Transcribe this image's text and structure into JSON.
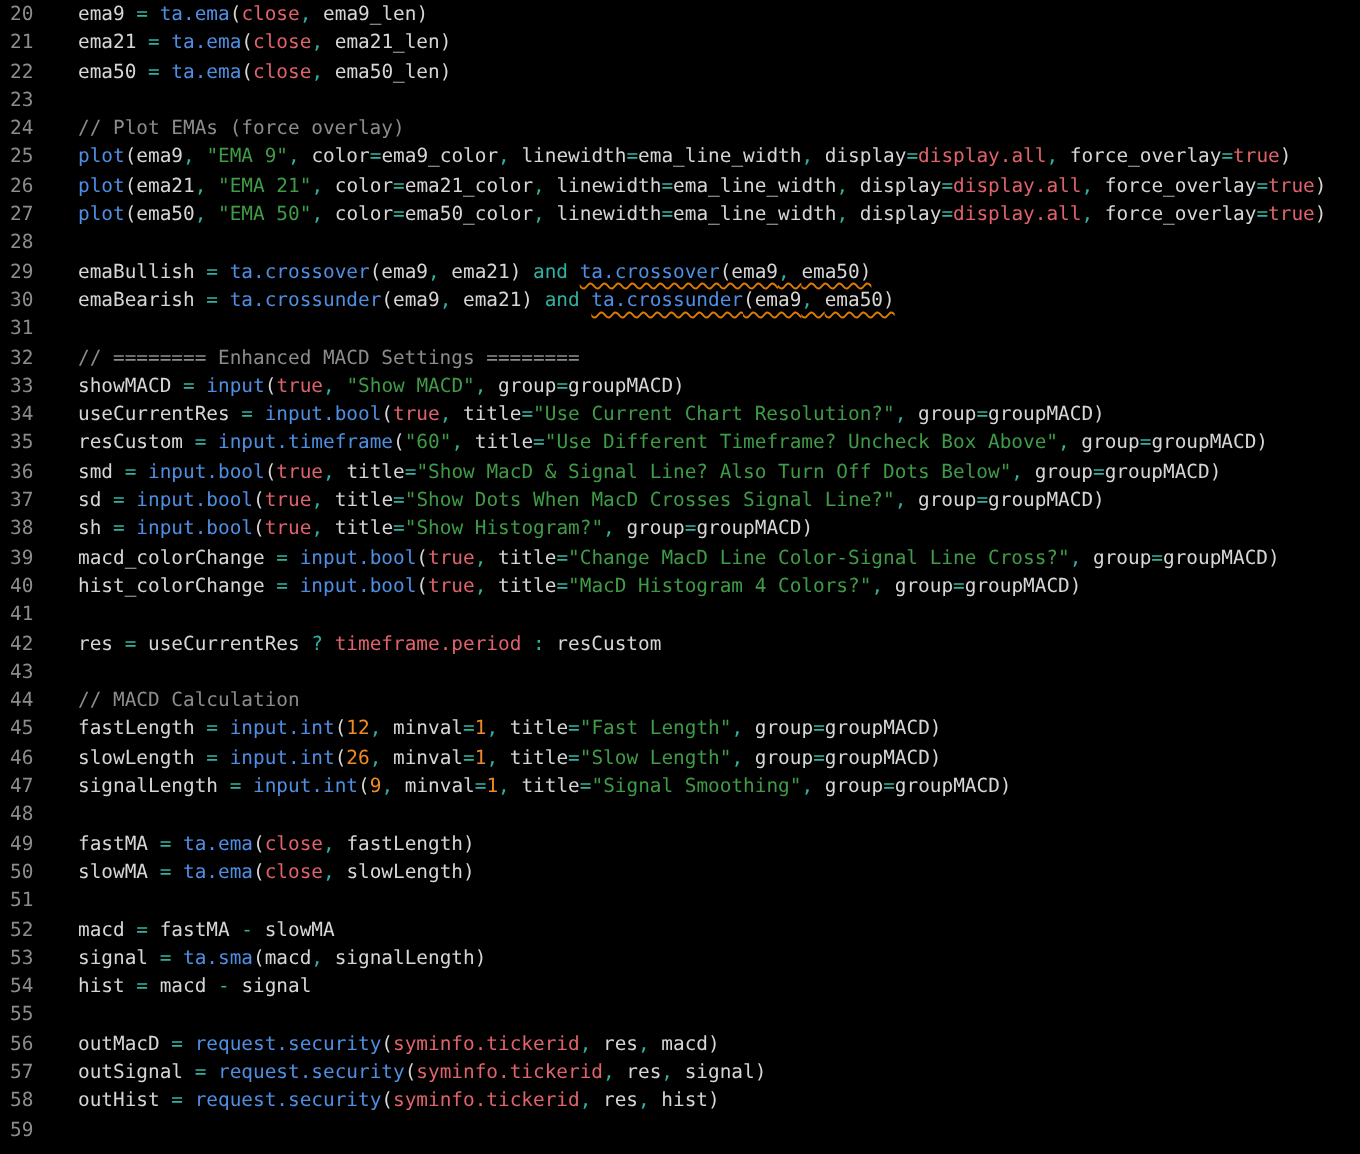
{
  "editor": {
    "lines": [
      {
        "number": "20",
        "tokens": [
          {
            "kind": "plain",
            "text": "ema9"
          },
          {
            "kind": "op",
            "text": " = "
          },
          {
            "kind": "fn",
            "text": "ta.ema"
          },
          {
            "kind": "plain",
            "text": "("
          },
          {
            "kind": "lit",
            "text": "close"
          },
          {
            "kind": "op",
            "text": ", "
          },
          {
            "kind": "plain",
            "text": "ema9_len)"
          }
        ]
      },
      {
        "number": "21",
        "tokens": [
          {
            "kind": "plain",
            "text": "ema21"
          },
          {
            "kind": "op",
            "text": " = "
          },
          {
            "kind": "fn",
            "text": "ta.ema"
          },
          {
            "kind": "plain",
            "text": "("
          },
          {
            "kind": "lit",
            "text": "close"
          },
          {
            "kind": "op",
            "text": ", "
          },
          {
            "kind": "plain",
            "text": "ema21_len)"
          }
        ]
      },
      {
        "number": "22",
        "tokens": [
          {
            "kind": "plain",
            "text": "ema50"
          },
          {
            "kind": "op",
            "text": " = "
          },
          {
            "kind": "fn",
            "text": "ta.ema"
          },
          {
            "kind": "plain",
            "text": "("
          },
          {
            "kind": "lit",
            "text": "close"
          },
          {
            "kind": "op",
            "text": ", "
          },
          {
            "kind": "plain",
            "text": "ema50_len)"
          }
        ]
      },
      {
        "number": "23"
      },
      {
        "number": "24",
        "tokens": [
          {
            "kind": "comment",
            "text": "// Plot EMAs (force overlay)"
          }
        ]
      },
      {
        "number": "25",
        "tokens": [
          {
            "kind": "fn",
            "text": "plot"
          },
          {
            "kind": "plain",
            "text": "(ema9"
          },
          {
            "kind": "op",
            "text": ", "
          },
          {
            "kind": "str",
            "text": "\"EMA 9\""
          },
          {
            "kind": "op",
            "text": ", "
          },
          {
            "kind": "plain",
            "text": "color"
          },
          {
            "kind": "op",
            "text": "="
          },
          {
            "kind": "plain",
            "text": "ema9_color"
          },
          {
            "kind": "op",
            "text": ", "
          },
          {
            "kind": "plain",
            "text": "linewidth"
          },
          {
            "kind": "op",
            "text": "="
          },
          {
            "kind": "plain",
            "text": "ema_line_width"
          },
          {
            "kind": "op",
            "text": ", "
          },
          {
            "kind": "plain",
            "text": "display"
          },
          {
            "kind": "op",
            "text": "="
          },
          {
            "kind": "lit",
            "text": "display.all"
          },
          {
            "kind": "op",
            "text": ", "
          },
          {
            "kind": "plain",
            "text": "force_overlay"
          },
          {
            "kind": "op",
            "text": "="
          },
          {
            "kind": "lit",
            "text": "true"
          },
          {
            "kind": "plain",
            "text": ")"
          }
        ]
      },
      {
        "number": "26",
        "tokens": [
          {
            "kind": "fn",
            "text": "plot"
          },
          {
            "kind": "plain",
            "text": "(ema21"
          },
          {
            "kind": "op",
            "text": ", "
          },
          {
            "kind": "str",
            "text": "\"EMA 21\""
          },
          {
            "kind": "op",
            "text": ", "
          },
          {
            "kind": "plain",
            "text": "color"
          },
          {
            "kind": "op",
            "text": "="
          },
          {
            "kind": "plain",
            "text": "ema21_color"
          },
          {
            "kind": "op",
            "text": ", "
          },
          {
            "kind": "plain",
            "text": "linewidth"
          },
          {
            "kind": "op",
            "text": "="
          },
          {
            "kind": "plain",
            "text": "ema_line_width"
          },
          {
            "kind": "op",
            "text": ", "
          },
          {
            "kind": "plain",
            "text": "display"
          },
          {
            "kind": "op",
            "text": "="
          },
          {
            "kind": "lit",
            "text": "display.all"
          },
          {
            "kind": "op",
            "text": ", "
          },
          {
            "kind": "plain",
            "text": "force_overlay"
          },
          {
            "kind": "op",
            "text": "="
          },
          {
            "kind": "lit",
            "text": "true"
          },
          {
            "kind": "plain",
            "text": ")"
          }
        ]
      },
      {
        "number": "27",
        "tokens": [
          {
            "kind": "fn",
            "text": "plot"
          },
          {
            "kind": "plain",
            "text": "(ema50"
          },
          {
            "kind": "op",
            "text": ", "
          },
          {
            "kind": "str",
            "text": "\"EMA 50\""
          },
          {
            "kind": "op",
            "text": ", "
          },
          {
            "kind": "plain",
            "text": "color"
          },
          {
            "kind": "op",
            "text": "="
          },
          {
            "kind": "plain",
            "text": "ema50_color"
          },
          {
            "kind": "op",
            "text": ", "
          },
          {
            "kind": "plain",
            "text": "linewidth"
          },
          {
            "kind": "op",
            "text": "="
          },
          {
            "kind": "plain",
            "text": "ema_line_width"
          },
          {
            "kind": "op",
            "text": ", "
          },
          {
            "kind": "plain",
            "text": "display"
          },
          {
            "kind": "op",
            "text": "="
          },
          {
            "kind": "lit",
            "text": "display.all"
          },
          {
            "kind": "op",
            "text": ", "
          },
          {
            "kind": "plain",
            "text": "force_overlay"
          },
          {
            "kind": "op",
            "text": "="
          },
          {
            "kind": "lit",
            "text": "true"
          },
          {
            "kind": "plain",
            "text": ")"
          }
        ]
      },
      {
        "number": "28"
      },
      {
        "number": "29",
        "tokens": [
          {
            "kind": "plain",
            "text": "emaBullish"
          },
          {
            "kind": "op",
            "text": " = "
          },
          {
            "kind": "fn",
            "text": "ta.crossover"
          },
          {
            "kind": "plain",
            "text": "(ema9"
          },
          {
            "kind": "op",
            "text": ", "
          },
          {
            "kind": "plain",
            "text": "ema21)"
          },
          {
            "kind": "op",
            "text": " and "
          },
          {
            "kind": "flagged",
            "tokens": [
              {
                "kind": "fn",
                "text": "ta.crossover"
              },
              {
                "kind": "plain",
                "text": "(ema9"
              },
              {
                "kind": "op",
                "text": ", "
              },
              {
                "kind": "plain",
                "text": "ema50)"
              }
            ]
          }
        ]
      },
      {
        "number": "30",
        "tokens": [
          {
            "kind": "plain",
            "text": "emaBearish"
          },
          {
            "kind": "op",
            "text": " = "
          },
          {
            "kind": "fn",
            "text": "ta.crossunder"
          },
          {
            "kind": "plain",
            "text": "(ema9"
          },
          {
            "kind": "op",
            "text": ", "
          },
          {
            "kind": "plain",
            "text": "ema21)"
          },
          {
            "kind": "op",
            "text": " and "
          },
          {
            "kind": "flagged",
            "tokens": [
              {
                "kind": "fn",
                "text": "ta.crossunder"
              },
              {
                "kind": "plain",
                "text": "(ema9"
              },
              {
                "kind": "op",
                "text": ", "
              },
              {
                "kind": "plain",
                "text": "ema50)"
              }
            ]
          }
        ]
      },
      {
        "number": "31"
      },
      {
        "number": "32",
        "tokens": [
          {
            "kind": "comment",
            "text": "// ======== Enhanced MACD Settings ========"
          }
        ]
      },
      {
        "number": "33",
        "tokens": [
          {
            "kind": "plain",
            "text": "showMACD"
          },
          {
            "kind": "op",
            "text": " = "
          },
          {
            "kind": "fn",
            "text": "input"
          },
          {
            "kind": "plain",
            "text": "("
          },
          {
            "kind": "lit",
            "text": "true"
          },
          {
            "kind": "op",
            "text": ", "
          },
          {
            "kind": "str",
            "text": "\"Show MACD\""
          },
          {
            "kind": "op",
            "text": ", "
          },
          {
            "kind": "plain",
            "text": "group"
          },
          {
            "kind": "op",
            "text": "="
          },
          {
            "kind": "plain",
            "text": "groupMACD)"
          }
        ]
      },
      {
        "number": "34",
        "tokens": [
          {
            "kind": "plain",
            "text": "useCurrentRes"
          },
          {
            "kind": "op",
            "text": " = "
          },
          {
            "kind": "fn",
            "text": "input.bool"
          },
          {
            "kind": "plain",
            "text": "("
          },
          {
            "kind": "lit",
            "text": "true"
          },
          {
            "kind": "op",
            "text": ", "
          },
          {
            "kind": "plain",
            "text": "title"
          },
          {
            "kind": "op",
            "text": "="
          },
          {
            "kind": "str",
            "text": "\"Use Current Chart Resolution?\""
          },
          {
            "kind": "op",
            "text": ", "
          },
          {
            "kind": "plain",
            "text": "group"
          },
          {
            "kind": "op",
            "text": "="
          },
          {
            "kind": "plain",
            "text": "groupMACD)"
          }
        ]
      },
      {
        "number": "35",
        "tokens": [
          {
            "kind": "plain",
            "text": "resCustom"
          },
          {
            "kind": "op",
            "text": " = "
          },
          {
            "kind": "fn",
            "text": "input.timeframe"
          },
          {
            "kind": "plain",
            "text": "("
          },
          {
            "kind": "str",
            "text": "\"60\""
          },
          {
            "kind": "op",
            "text": ", "
          },
          {
            "kind": "plain",
            "text": "title"
          },
          {
            "kind": "op",
            "text": "="
          },
          {
            "kind": "str",
            "text": "\"Use Different Timeframe? Uncheck Box Above\""
          },
          {
            "kind": "op",
            "text": ", "
          },
          {
            "kind": "plain",
            "text": "group"
          },
          {
            "kind": "op",
            "text": "="
          },
          {
            "kind": "plain",
            "text": "groupMACD)"
          }
        ]
      },
      {
        "number": "36",
        "tokens": [
          {
            "kind": "plain",
            "text": "smd"
          },
          {
            "kind": "op",
            "text": " = "
          },
          {
            "kind": "fn",
            "text": "input.bool"
          },
          {
            "kind": "plain",
            "text": "("
          },
          {
            "kind": "lit",
            "text": "true"
          },
          {
            "kind": "op",
            "text": ", "
          },
          {
            "kind": "plain",
            "text": "title"
          },
          {
            "kind": "op",
            "text": "="
          },
          {
            "kind": "str",
            "text": "\"Show MacD & Signal Line? Also Turn Off Dots Below\""
          },
          {
            "kind": "op",
            "text": ", "
          },
          {
            "kind": "plain",
            "text": "group"
          },
          {
            "kind": "op",
            "text": "="
          },
          {
            "kind": "plain",
            "text": "groupMACD)"
          }
        ]
      },
      {
        "number": "37",
        "tokens": [
          {
            "kind": "plain",
            "text": "sd"
          },
          {
            "kind": "op",
            "text": " = "
          },
          {
            "kind": "fn",
            "text": "input.bool"
          },
          {
            "kind": "plain",
            "text": "("
          },
          {
            "kind": "lit",
            "text": "true"
          },
          {
            "kind": "op",
            "text": ", "
          },
          {
            "kind": "plain",
            "text": "title"
          },
          {
            "kind": "op",
            "text": "="
          },
          {
            "kind": "str",
            "text": "\"Show Dots When MacD Crosses Signal Line?\""
          },
          {
            "kind": "op",
            "text": ", "
          },
          {
            "kind": "plain",
            "text": "group"
          },
          {
            "kind": "op",
            "text": "="
          },
          {
            "kind": "plain",
            "text": "groupMACD)"
          }
        ]
      },
      {
        "number": "38",
        "tokens": [
          {
            "kind": "plain",
            "text": "sh"
          },
          {
            "kind": "op",
            "text": " = "
          },
          {
            "kind": "fn",
            "text": "input.bool"
          },
          {
            "kind": "plain",
            "text": "("
          },
          {
            "kind": "lit",
            "text": "true"
          },
          {
            "kind": "op",
            "text": ", "
          },
          {
            "kind": "plain",
            "text": "title"
          },
          {
            "kind": "op",
            "text": "="
          },
          {
            "kind": "str",
            "text": "\"Show Histogram?\""
          },
          {
            "kind": "op",
            "text": ", "
          },
          {
            "kind": "plain",
            "text": "group"
          },
          {
            "kind": "op",
            "text": "="
          },
          {
            "kind": "plain",
            "text": "groupMACD)"
          }
        ]
      },
      {
        "number": "39",
        "tokens": [
          {
            "kind": "plain",
            "text": "macd_colorChange"
          },
          {
            "kind": "op",
            "text": " = "
          },
          {
            "kind": "fn",
            "text": "input.bool"
          },
          {
            "kind": "plain",
            "text": "("
          },
          {
            "kind": "lit",
            "text": "true"
          },
          {
            "kind": "op",
            "text": ", "
          },
          {
            "kind": "plain",
            "text": "title"
          },
          {
            "kind": "op",
            "text": "="
          },
          {
            "kind": "str",
            "text": "\"Change MacD Line Color-Signal Line Cross?\""
          },
          {
            "kind": "op",
            "text": ", "
          },
          {
            "kind": "plain",
            "text": "group"
          },
          {
            "kind": "op",
            "text": "="
          },
          {
            "kind": "plain",
            "text": "groupMACD)"
          }
        ]
      },
      {
        "number": "40",
        "tokens": [
          {
            "kind": "plain",
            "text": "hist_colorChange"
          },
          {
            "kind": "op",
            "text": " = "
          },
          {
            "kind": "fn",
            "text": "input.bool"
          },
          {
            "kind": "plain",
            "text": "("
          },
          {
            "kind": "lit",
            "text": "true"
          },
          {
            "kind": "op",
            "text": ", "
          },
          {
            "kind": "plain",
            "text": "title"
          },
          {
            "kind": "op",
            "text": "="
          },
          {
            "kind": "str",
            "text": "\"MacD Histogram 4 Colors?\""
          },
          {
            "kind": "op",
            "text": ", "
          },
          {
            "kind": "plain",
            "text": "group"
          },
          {
            "kind": "op",
            "text": "="
          },
          {
            "kind": "plain",
            "text": "groupMACD)"
          }
        ]
      },
      {
        "number": "41"
      },
      {
        "number": "42",
        "tokens": [
          {
            "kind": "plain",
            "text": "res"
          },
          {
            "kind": "op",
            "text": " = "
          },
          {
            "kind": "plain",
            "text": "useCurrentRes"
          },
          {
            "kind": "op",
            "text": " ? "
          },
          {
            "kind": "lit",
            "text": "timeframe.period"
          },
          {
            "kind": "op",
            "text": " : "
          },
          {
            "kind": "plain",
            "text": "resCustom"
          }
        ]
      },
      {
        "number": "43"
      },
      {
        "number": "44",
        "tokens": [
          {
            "kind": "comment",
            "text": "// MACD Calculation"
          }
        ]
      },
      {
        "number": "45",
        "tokens": [
          {
            "kind": "plain",
            "text": "fastLength"
          },
          {
            "kind": "op",
            "text": " = "
          },
          {
            "kind": "fn",
            "text": "input.int"
          },
          {
            "kind": "plain",
            "text": "("
          },
          {
            "kind": "num",
            "text": "12"
          },
          {
            "kind": "op",
            "text": ", "
          },
          {
            "kind": "plain",
            "text": "minval"
          },
          {
            "kind": "op",
            "text": "="
          },
          {
            "kind": "num",
            "text": "1"
          },
          {
            "kind": "op",
            "text": ", "
          },
          {
            "kind": "plain",
            "text": "title"
          },
          {
            "kind": "op",
            "text": "="
          },
          {
            "kind": "str",
            "text": "\"Fast Length\""
          },
          {
            "kind": "op",
            "text": ", "
          },
          {
            "kind": "plain",
            "text": "group"
          },
          {
            "kind": "op",
            "text": "="
          },
          {
            "kind": "plain",
            "text": "groupMACD)"
          }
        ]
      },
      {
        "number": "46",
        "tokens": [
          {
            "kind": "plain",
            "text": "slowLength"
          },
          {
            "kind": "op",
            "text": " = "
          },
          {
            "kind": "fn",
            "text": "input.int"
          },
          {
            "kind": "plain",
            "text": "("
          },
          {
            "kind": "num",
            "text": "26"
          },
          {
            "kind": "op",
            "text": ", "
          },
          {
            "kind": "plain",
            "text": "minval"
          },
          {
            "kind": "op",
            "text": "="
          },
          {
            "kind": "num",
            "text": "1"
          },
          {
            "kind": "op",
            "text": ", "
          },
          {
            "kind": "plain",
            "text": "title"
          },
          {
            "kind": "op",
            "text": "="
          },
          {
            "kind": "str",
            "text": "\"Slow Length\""
          },
          {
            "kind": "op",
            "text": ", "
          },
          {
            "kind": "plain",
            "text": "group"
          },
          {
            "kind": "op",
            "text": "="
          },
          {
            "kind": "plain",
            "text": "groupMACD)"
          }
        ]
      },
      {
        "number": "47",
        "tokens": [
          {
            "kind": "plain",
            "text": "signalLength"
          },
          {
            "kind": "op",
            "text": " = "
          },
          {
            "kind": "fn",
            "text": "input.int"
          },
          {
            "kind": "plain",
            "text": "("
          },
          {
            "kind": "num",
            "text": "9"
          },
          {
            "kind": "op",
            "text": ", "
          },
          {
            "kind": "plain",
            "text": "minval"
          },
          {
            "kind": "op",
            "text": "="
          },
          {
            "kind": "num",
            "text": "1"
          },
          {
            "kind": "op",
            "text": ", "
          },
          {
            "kind": "plain",
            "text": "title"
          },
          {
            "kind": "op",
            "text": "="
          },
          {
            "kind": "str",
            "text": "\"Signal Smoothing\""
          },
          {
            "kind": "op",
            "text": ", "
          },
          {
            "kind": "plain",
            "text": "group"
          },
          {
            "kind": "op",
            "text": "="
          },
          {
            "kind": "plain",
            "text": "groupMACD)"
          }
        ]
      },
      {
        "number": "48"
      },
      {
        "number": "49",
        "tokens": [
          {
            "kind": "plain",
            "text": "fastMA"
          },
          {
            "kind": "op",
            "text": " = "
          },
          {
            "kind": "fn",
            "text": "ta.ema"
          },
          {
            "kind": "plain",
            "text": "("
          },
          {
            "kind": "lit",
            "text": "close"
          },
          {
            "kind": "op",
            "text": ", "
          },
          {
            "kind": "plain",
            "text": "fastLength)"
          }
        ]
      },
      {
        "number": "50",
        "tokens": [
          {
            "kind": "plain",
            "text": "slowMA"
          },
          {
            "kind": "op",
            "text": " = "
          },
          {
            "kind": "fn",
            "text": "ta.ema"
          },
          {
            "kind": "plain",
            "text": "("
          },
          {
            "kind": "lit",
            "text": "close"
          },
          {
            "kind": "op",
            "text": ", "
          },
          {
            "kind": "plain",
            "text": "slowLength)"
          }
        ]
      },
      {
        "number": "51"
      },
      {
        "number": "52",
        "tokens": [
          {
            "kind": "plain",
            "text": "macd"
          },
          {
            "kind": "op",
            "text": " = "
          },
          {
            "kind": "plain",
            "text": "fastMA"
          },
          {
            "kind": "op",
            "text": " - "
          },
          {
            "kind": "plain",
            "text": "slowMA"
          }
        ]
      },
      {
        "number": "53",
        "tokens": [
          {
            "kind": "plain",
            "text": "signal"
          },
          {
            "kind": "op",
            "text": " = "
          },
          {
            "kind": "fn",
            "text": "ta.sma"
          },
          {
            "kind": "plain",
            "text": "(macd"
          },
          {
            "kind": "op",
            "text": ", "
          },
          {
            "kind": "plain",
            "text": "signalLength)"
          }
        ]
      },
      {
        "number": "54",
        "tokens": [
          {
            "kind": "plain",
            "text": "hist"
          },
          {
            "kind": "op",
            "text": " = "
          },
          {
            "kind": "plain",
            "text": "macd"
          },
          {
            "kind": "op",
            "text": " - "
          },
          {
            "kind": "plain",
            "text": "signal"
          }
        ]
      },
      {
        "number": "55"
      },
      {
        "number": "56",
        "tokens": [
          {
            "kind": "plain",
            "text": "outMacD"
          },
          {
            "kind": "op",
            "text": " = "
          },
          {
            "kind": "fn",
            "text": "request.security"
          },
          {
            "kind": "plain",
            "text": "("
          },
          {
            "kind": "lit",
            "text": "syminfo.tickerid"
          },
          {
            "kind": "op",
            "text": ", "
          },
          {
            "kind": "plain",
            "text": "res"
          },
          {
            "kind": "op",
            "text": ", "
          },
          {
            "kind": "plain",
            "text": "macd)"
          }
        ]
      },
      {
        "number": "57",
        "tokens": [
          {
            "kind": "plain",
            "text": "outSignal"
          },
          {
            "kind": "op",
            "text": " = "
          },
          {
            "kind": "fn",
            "text": "request.security"
          },
          {
            "kind": "plain",
            "text": "("
          },
          {
            "kind": "lit",
            "text": "syminfo.tickerid"
          },
          {
            "kind": "op",
            "text": ", "
          },
          {
            "kind": "plain",
            "text": "res"
          },
          {
            "kind": "op",
            "text": ", "
          },
          {
            "kind": "plain",
            "text": "signal)"
          }
        ]
      },
      {
        "number": "58",
        "tokens": [
          {
            "kind": "plain",
            "text": "outHist"
          },
          {
            "kind": "op",
            "text": " = "
          },
          {
            "kind": "fn",
            "text": "request.security"
          },
          {
            "kind": "plain",
            "text": "("
          },
          {
            "kind": "lit",
            "text": "syminfo.tickerid"
          },
          {
            "kind": "op",
            "text": ", "
          },
          {
            "kind": "plain",
            "text": "res"
          },
          {
            "kind": "op",
            "text": ", "
          },
          {
            "kind": "plain",
            "text": "hist)"
          }
        ]
      },
      {
        "number": "59"
      }
    ]
  }
}
